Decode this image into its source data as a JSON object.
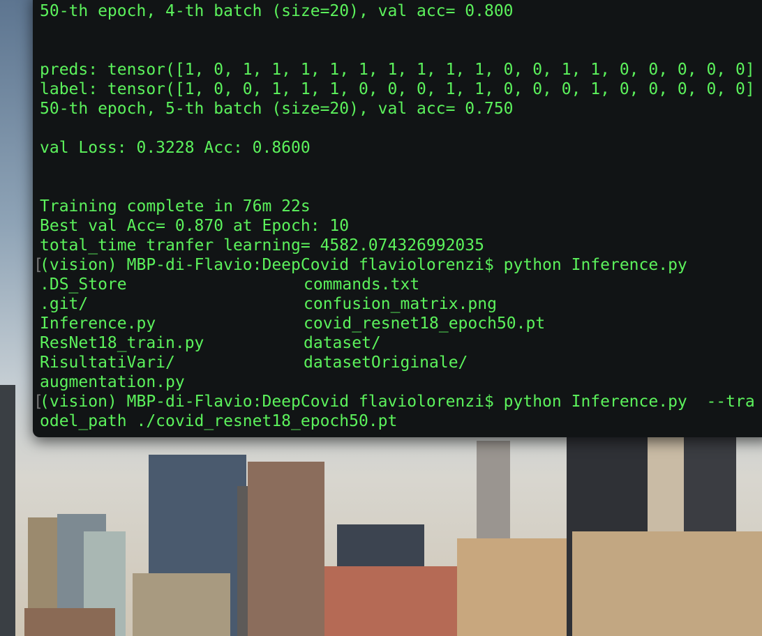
{
  "terminal": {
    "text_color": "#5cf25c",
    "background": "#111415",
    "lines": [
      "50-th epoch, 4-th batch (size=20), val acc= 0.800",
      "",
      "",
      "preds: tensor([1, 0, 1, 1, 1, 1, 1, 1, 1, 1, 1, 0, 0, 1, 1, 0, 0, 0, 0, 0]",
      "label: tensor([1, 0, 0, 1, 1, 1, 0, 0, 0, 1, 1, 0, 0, 0, 1, 0, 0, 0, 0, 0]",
      "50-th epoch, 5-th batch (size=20), val acc= 0.750",
      "",
      "val Loss: 0.3228 Acc: 0.8600",
      "",
      "",
      "Training complete in 76m 22s",
      "Best val Acc= 0.870 at Epoch: 10",
      "total_time tranfer learning= 4582.074326992035"
    ],
    "prompt1": "(vision) MBP-di-Flavio:DeepCovid flaviolorenzi$ python Inference.py",
    "ls_rows": [
      [
        ".DS_Store",
        "commands.txt"
      ],
      [
        ".git/",
        "confusion_matrix.png"
      ],
      [
        "Inference.py",
        "covid_resnet18_epoch50.pt"
      ],
      [
        "ResNet18_train.py",
        "dataset/"
      ],
      [
        "RisultatiVari/",
        "datasetOriginale/"
      ],
      [
        "augmentation.py",
        ""
      ]
    ],
    "prompt2": "(vision) MBP-di-Flavio:DeepCovid flaviolorenzi$ python Inference.py  --tra",
    "prompt2_cont": "odel_path ./covid_resnet18_epoch50.pt"
  },
  "desktop": {
    "wallpaper": "city-skyline"
  }
}
